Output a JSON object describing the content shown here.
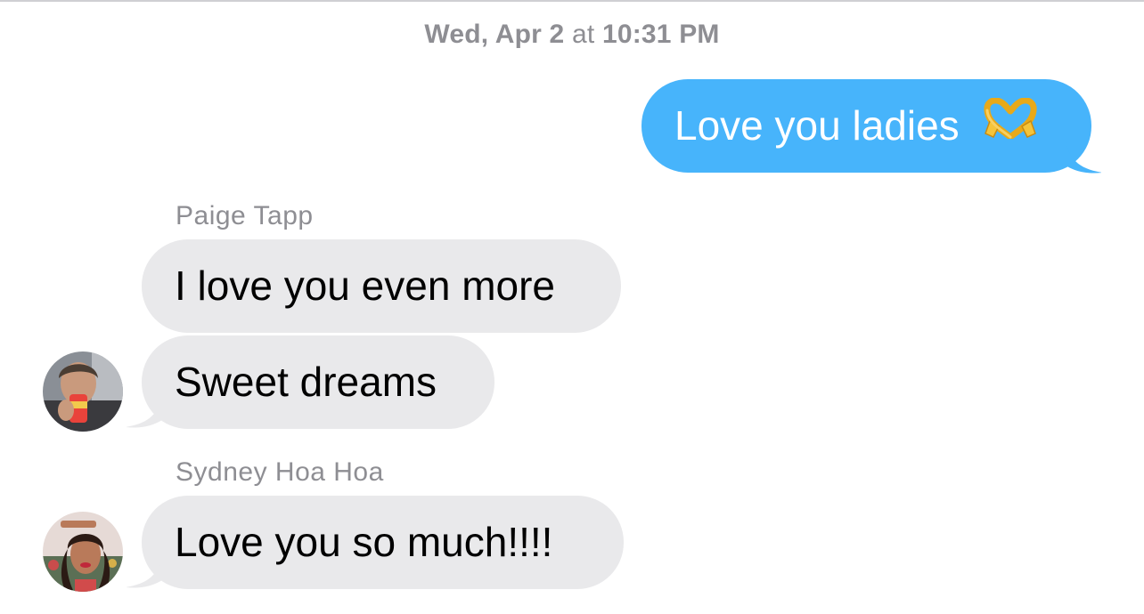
{
  "conversation": {
    "timestamp": {
      "date": "Wed, Apr 2",
      "at": "at",
      "time": "10:31 PM"
    },
    "messages": [
      {
        "direction": "outgoing",
        "text": "Love you ladies",
        "emoji": "heart-hands-icon"
      },
      {
        "direction": "incoming",
        "sender": "Paige Tapp",
        "text": "I love you even more"
      },
      {
        "direction": "incoming",
        "text": "Sweet dreams",
        "avatar": "paige-avatar"
      },
      {
        "direction": "incoming",
        "sender": "Sydney Hoa Hoa",
        "text": "Love you so much!!!!",
        "avatar": "sydney-avatar"
      }
    ]
  },
  "colors": {
    "outgoing_bubble": "#47b4fb",
    "incoming_bubble": "#e9e9eb",
    "meta_text": "#8e8e93"
  }
}
